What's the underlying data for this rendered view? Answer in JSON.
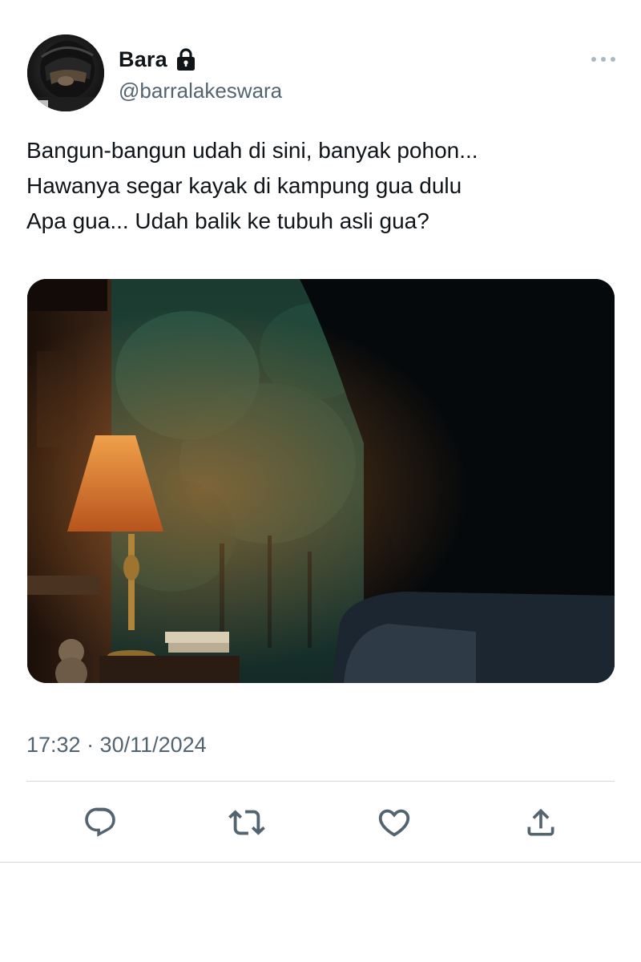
{
  "tweet": {
    "display_name": "Bara",
    "handle": "@barralakeswara",
    "is_protected": true,
    "text_lines": [
      "Bangun-bangun udah di sini, banyak pohon...",
      "Hawanya segar kayak di kampung gua dulu",
      "Apa gua... Udah balik ke tubuh asli gua?"
    ],
    "timestamp": "17:32 · 30/11/2024"
  },
  "icons": {
    "header": [
      "lock-icon",
      "more-options-icon"
    ],
    "actions": [
      "reply-icon",
      "retweet-icon",
      "like-icon",
      "share-icon"
    ]
  },
  "colors": {
    "text_primary": "#0f1419",
    "text_secondary": "#536471",
    "divider": "#cfd9de",
    "icon": "#536471"
  }
}
